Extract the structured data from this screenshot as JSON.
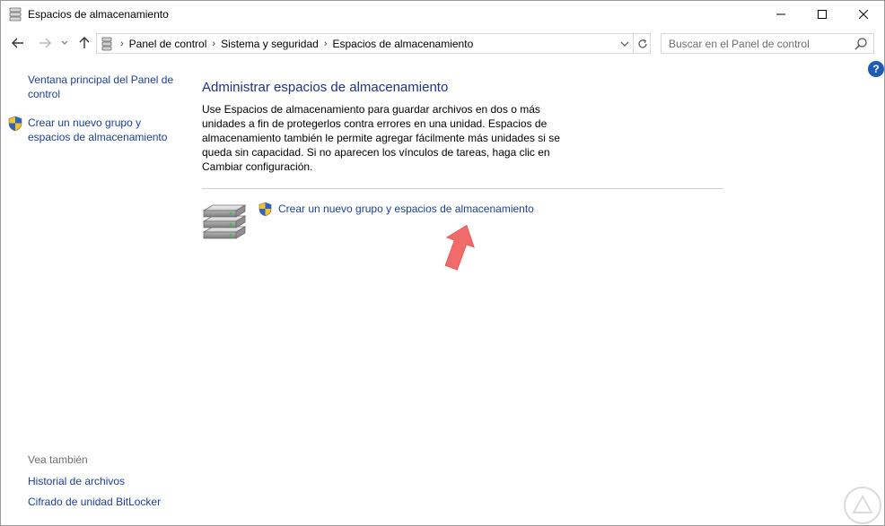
{
  "window": {
    "title": "Espacios de almacenamiento",
    "icon": "storage-spaces-icon"
  },
  "nav": {
    "back_icon": "back-arrow-icon",
    "forward_icon": "forward-arrow-icon",
    "recent_icon": "chevron-down-icon",
    "up_icon": "up-arrow-icon"
  },
  "address": {
    "breadcrumbs": [
      "Panel de control",
      "Sistema y seguridad",
      "Espacios de almacenamiento"
    ],
    "dropdown_icon": "chevron-down-icon",
    "refresh_icon": "refresh-icon"
  },
  "search": {
    "placeholder": "Buscar en el Panel de control",
    "value": ""
  },
  "help": {
    "label": "?"
  },
  "left_pane": {
    "home_link": "Ventana principal del Panel de control",
    "create_link": "Crear un nuevo grupo y espacios de almacenamiento",
    "see_also_label": "Vea también",
    "see_also_links": [
      "Historial de archivos",
      "Cifrado de unidad BitLocker"
    ]
  },
  "main": {
    "title": "Administrar espacios de almacenamiento",
    "description": "Use Espacios de almacenamiento para guardar archivos en dos o más unidades a fin de protegerlos contra errores en una unidad. Espacios de almacenamiento también le permite agregar fácilmente más unidades si se queda sin capacidad. Si no aparecen los vínculos de tareas, haga clic en Cambiar configuración.",
    "create_link": "Crear un nuevo grupo y espacios de almacenamiento"
  },
  "colors": {
    "link": "#1a3e9c",
    "heading": "#1e3287",
    "annotation_arrow": "#f26b6b",
    "help_button": "#1e5bb8"
  }
}
